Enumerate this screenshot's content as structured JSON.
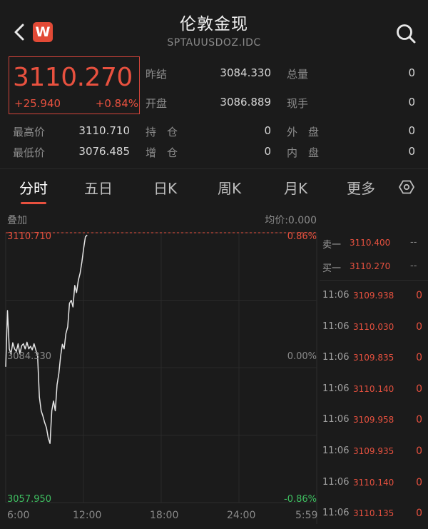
{
  "header": {
    "title": "伦敦金现",
    "subtitle": "SPTAUUSDOZ.IDC",
    "logo_letter": "W"
  },
  "quote": {
    "price": "3110.270",
    "change": "+25.940",
    "change_pct": "+0.84%",
    "stats": [
      {
        "label": "昨结",
        "value": "3084.330"
      },
      {
        "label": "总量",
        "value": "0"
      },
      {
        "label": "开盘",
        "value": "3086.889"
      },
      {
        "label": "现手",
        "value": "0"
      },
      {
        "label": "最高价",
        "value": "3110.710"
      },
      {
        "label": "持　仓",
        "value": "0"
      },
      {
        "label": "外　盘",
        "value": "0"
      },
      {
        "label": "最低价",
        "value": "3076.485"
      },
      {
        "label": "增　仓",
        "value": "0"
      },
      {
        "label": "内　盘",
        "value": "0"
      }
    ]
  },
  "tabs": [
    "分时",
    "五日",
    "日K",
    "周K",
    "月K",
    "更多"
  ],
  "chart": {
    "overlay_label": "叠加",
    "avg_price_label": "均价:0.000",
    "y_top": "3110.710",
    "y_mid": "3084.330",
    "y_bottom": "3057.950",
    "pct_top": "0.86%",
    "pct_mid": "0.00%",
    "pct_bottom": "-0.86%",
    "time_labels": [
      "6:00",
      "12:00",
      "18:00",
      "24:00",
      "5:59"
    ]
  },
  "chart_data": {
    "type": "line",
    "ylim": [
      3057.95,
      3110.71
    ],
    "x_ticks": [
      "6:00",
      "12:00",
      "18:00",
      "24:00",
      "5:59"
    ],
    "x_index_range": [
      0,
      1440
    ],
    "x": [
      0,
      2,
      4,
      6,
      8,
      10,
      12,
      14,
      16,
      18,
      20,
      22,
      24,
      26,
      28,
      30,
      32,
      34,
      36,
      38,
      40,
      42,
      44,
      46,
      48,
      50,
      52,
      54,
      56,
      58,
      60,
      62,
      64,
      66,
      68,
      70,
      72,
      74,
      76,
      78,
      80,
      82,
      84,
      86,
      88,
      90,
      92
    ],
    "y": [
      3084.5,
      3095.5,
      3088.0,
      3087.0,
      3089.2,
      3088.0,
      3087.5,
      3089.0,
      3087.0,
      3088.6,
      3089.0,
      3088.0,
      3089.3,
      3088.0,
      3088.5,
      3087.8,
      3089.0,
      3087.8,
      3086.6,
      3078.6,
      3075.9,
      3074.9,
      3073.6,
      3072.6,
      3070.6,
      3069.5,
      3075.9,
      3077.8,
      3075.9,
      3081.0,
      3083.2,
      3086.6,
      3088.9,
      3088.0,
      3091.0,
      3092.3,
      3096.9,
      3097.5,
      3096.2,
      3100.4,
      3099.0,
      3101.4,
      3102.8,
      3105.0,
      3107.6,
      3109.9,
      3110.27
    ]
  },
  "orderbook": {
    "asks": [
      {
        "label": "卖一",
        "price": "3110.400",
        "vol": "--"
      }
    ],
    "bids": [
      {
        "label": "买一",
        "price": "3110.270",
        "vol": "--"
      }
    ],
    "ticks": [
      {
        "time": "11:06",
        "price": "3109.938",
        "vol": "0"
      },
      {
        "time": "11:06",
        "price": "3110.030",
        "vol": "0"
      },
      {
        "time": "11:06",
        "price": "3109.835",
        "vol": "0"
      },
      {
        "time": "11:06",
        "price": "3110.140",
        "vol": "0"
      },
      {
        "time": "11:06",
        "price": "3109.958",
        "vol": "0"
      },
      {
        "time": "11:06",
        "price": "3109.935",
        "vol": "0"
      },
      {
        "time": "11:06",
        "price": "3110.140",
        "vol": "0"
      },
      {
        "time": "11:06",
        "price": "3110.135",
        "vol": "0"
      }
    ]
  },
  "colors": {
    "up": "#e8513f",
    "down": "#3fbf61",
    "bg": "#1b1b1b",
    "line": "#e6e6e6"
  }
}
